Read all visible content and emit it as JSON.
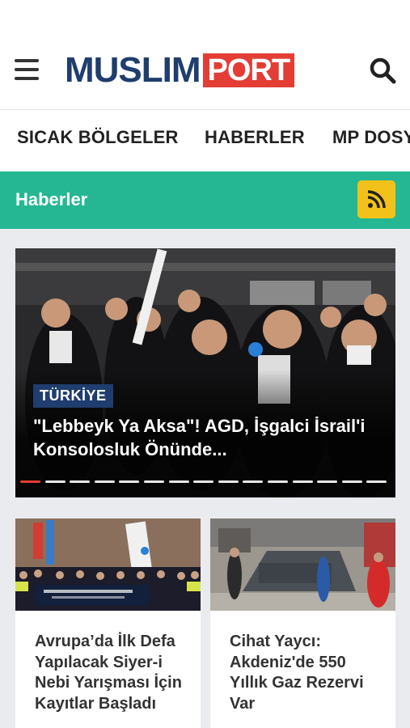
{
  "header": {
    "logo_main": "MUSLIM",
    "logo_accent": "PORT",
    "menu_icon": "hamburger-menu-icon",
    "search_icon": "search-icon"
  },
  "nav": {
    "items": [
      {
        "label": "SICAK BÖLGELER"
      },
      {
        "label": "HABERLER"
      },
      {
        "label": "MP DOSYA"
      }
    ]
  },
  "section": {
    "title": "Haberler",
    "rss_icon": "rss-feed-icon",
    "color": "#25b793",
    "rss_color": "#f3c21a"
  },
  "slider": {
    "tag": "TÜRKİYE",
    "title": "\"Lebbeyk Ya Aksa\"! AGD, İşgalci İsrail'i Konsolosluk Önünde...",
    "slide_count": 15,
    "active_index": 0
  },
  "cards": [
    {
      "title": "Avrupa’da İlk Defa Yapılacak Siyer-i Nebi Yarışması İçin Kayıtlar Başladı"
    },
    {
      "title": "Cihat Yaycı: Akdeniz'de 550 Yıllık Gaz Rezervi Var"
    }
  ],
  "colors": {
    "brand_navy": "#1f3d6e",
    "brand_red": "#e33d35"
  }
}
